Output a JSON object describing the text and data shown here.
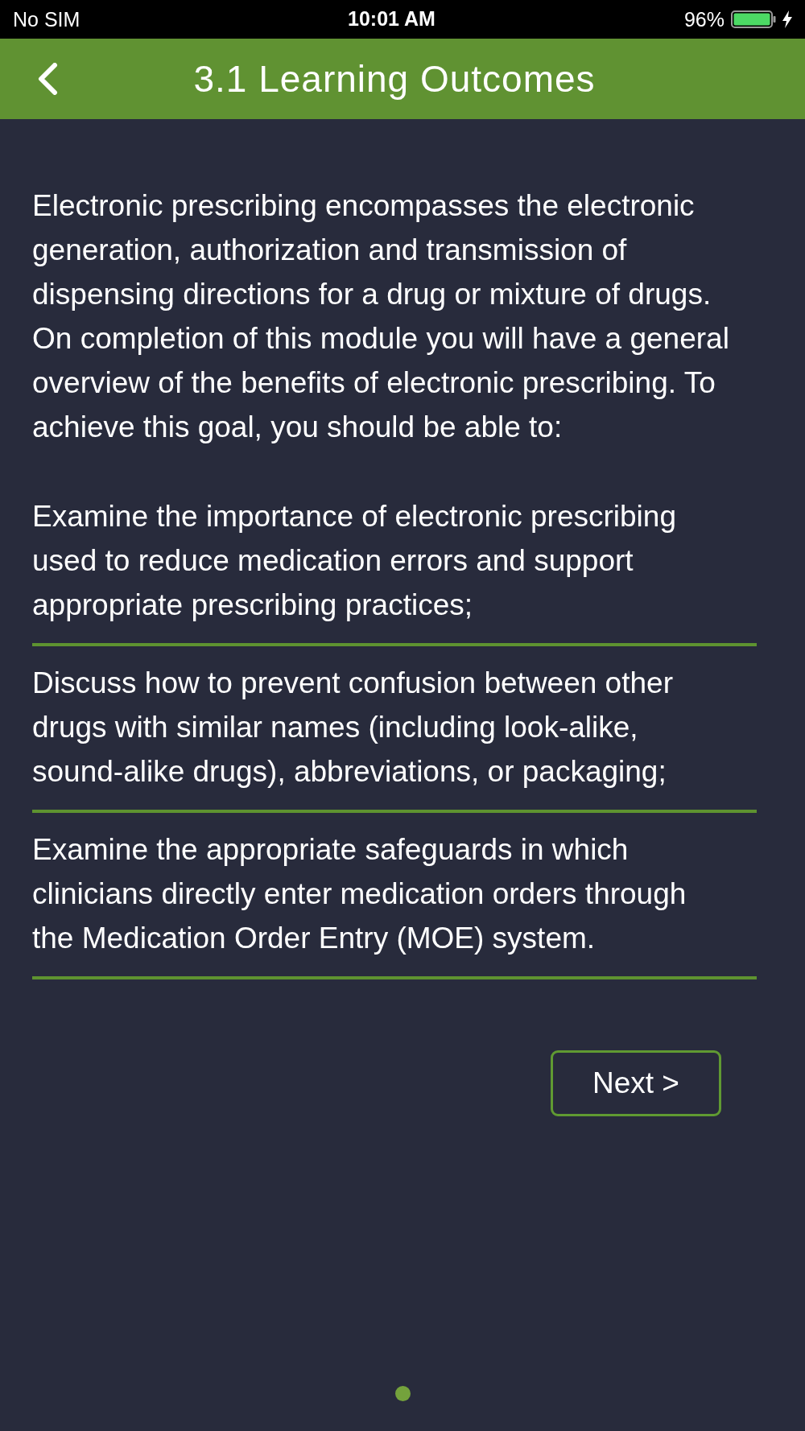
{
  "status_bar": {
    "carrier": "No SIM",
    "time": "10:01 AM",
    "battery": "96%"
  },
  "header": {
    "title": "3.1 Learning Outcomes"
  },
  "intro": "Electronic prescribing encompasses the electronic generation, authorization and transmission of dispensing directions for a drug or mixture of drugs. On completion of this module you will have a general overview of the benefits of electronic prescribing. To achieve this goal, you should be able to:",
  "outcomes": [
    "Examine the importance of electronic prescribing used to reduce medication errors and support appropriate prescribing practices;",
    "Discuss how to prevent confusion between other drugs with similar names (including look-alike, sound-alike drugs), abbreviations, or packaging;",
    "Examine the appropriate safeguards in which clinicians directly enter medication orders through the Medication Order Entry (MOE) system."
  ],
  "next_button": {
    "label": "Next >"
  },
  "page_dots": [
    {
      "selected": true
    }
  ]
}
